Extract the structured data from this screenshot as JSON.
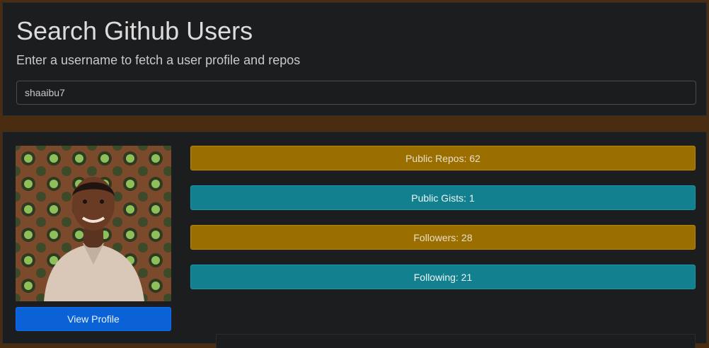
{
  "search": {
    "title": "Search Github Users",
    "subtitle": "Enter a username to fetch a user profile and repos",
    "input_value": "shaaibu7"
  },
  "profile": {
    "avatar_icon": "user-avatar-photo",
    "view_profile_label": "View Profile",
    "stats": {
      "public_repos": "Public Repos: 62",
      "public_gists": "Public Gists: 1",
      "followers": "Followers: 28",
      "following": "Following: 21"
    }
  },
  "colors": {
    "page_background": "#4a2c10",
    "card_background": "#1c1d1f",
    "primary": "#0a62d6",
    "amber": "#9b6e00",
    "teal": "#12808f"
  }
}
